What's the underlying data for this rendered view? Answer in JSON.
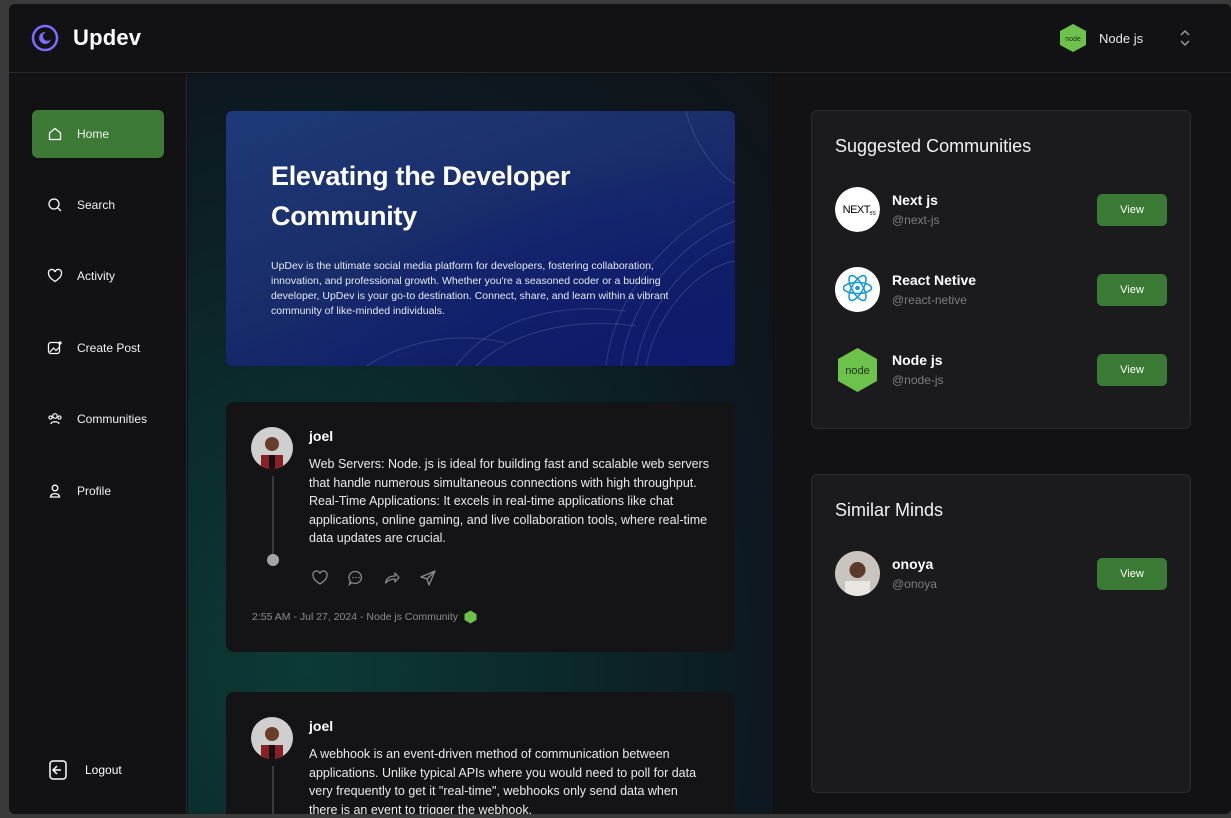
{
  "brand": {
    "name": "Updev"
  },
  "org_switch": {
    "label": "Node js"
  },
  "sidebar": {
    "items": [
      {
        "label": "Home"
      },
      {
        "label": "Search"
      },
      {
        "label": "Activity"
      },
      {
        "label": "Create Post"
      },
      {
        "label": "Communities"
      },
      {
        "label": "Profile"
      }
    ],
    "logout": "Logout"
  },
  "hero": {
    "title": "Elevating the Developer Community",
    "text": "UpDev is the ultimate social media platform for developers, fostering collaboration, innovation, and professional growth. Whether you're a seasoned coder or a budding developer, UpDev is your go-to destination. Connect, share, and learn within a vibrant community of like-minded individuals."
  },
  "posts": [
    {
      "author": "joel",
      "body": "Web Servers: Node. js is ideal for building fast and scalable web servers that handle numerous simultaneous connections with high throughput. Real-Time Applications: It excels in real-time applications like chat applications, online gaming, and live collaboration tools, where real-time data updates are crucial.",
      "meta": "2:55 AM - Jul 27, 2024 - Node js Community"
    },
    {
      "author": "joel",
      "body": "A webhook is an event-driven method of communication between applications. Unlike typical APIs where you would need to poll for data very frequently to get it \"real-time\", webhooks only send data when there is an event to trigger the webhook."
    }
  ],
  "suggested": {
    "title": "Suggested Communities",
    "items": [
      {
        "name": "Next js",
        "handle": "@next-js",
        "button": "View"
      },
      {
        "name": "React Netive",
        "handle": "@react-netive",
        "button": "View"
      },
      {
        "name": "Node js",
        "handle": "@node-js",
        "button": "View"
      }
    ]
  },
  "similar": {
    "title": "Similar Minds",
    "items": [
      {
        "name": "onoya",
        "handle": "@onoya",
        "button": "View"
      }
    ]
  },
  "colors": {
    "accent": "#3d7a35",
    "brand_logo": "#6b5cff",
    "node": "#6cc24a",
    "react": "#61dafb"
  }
}
